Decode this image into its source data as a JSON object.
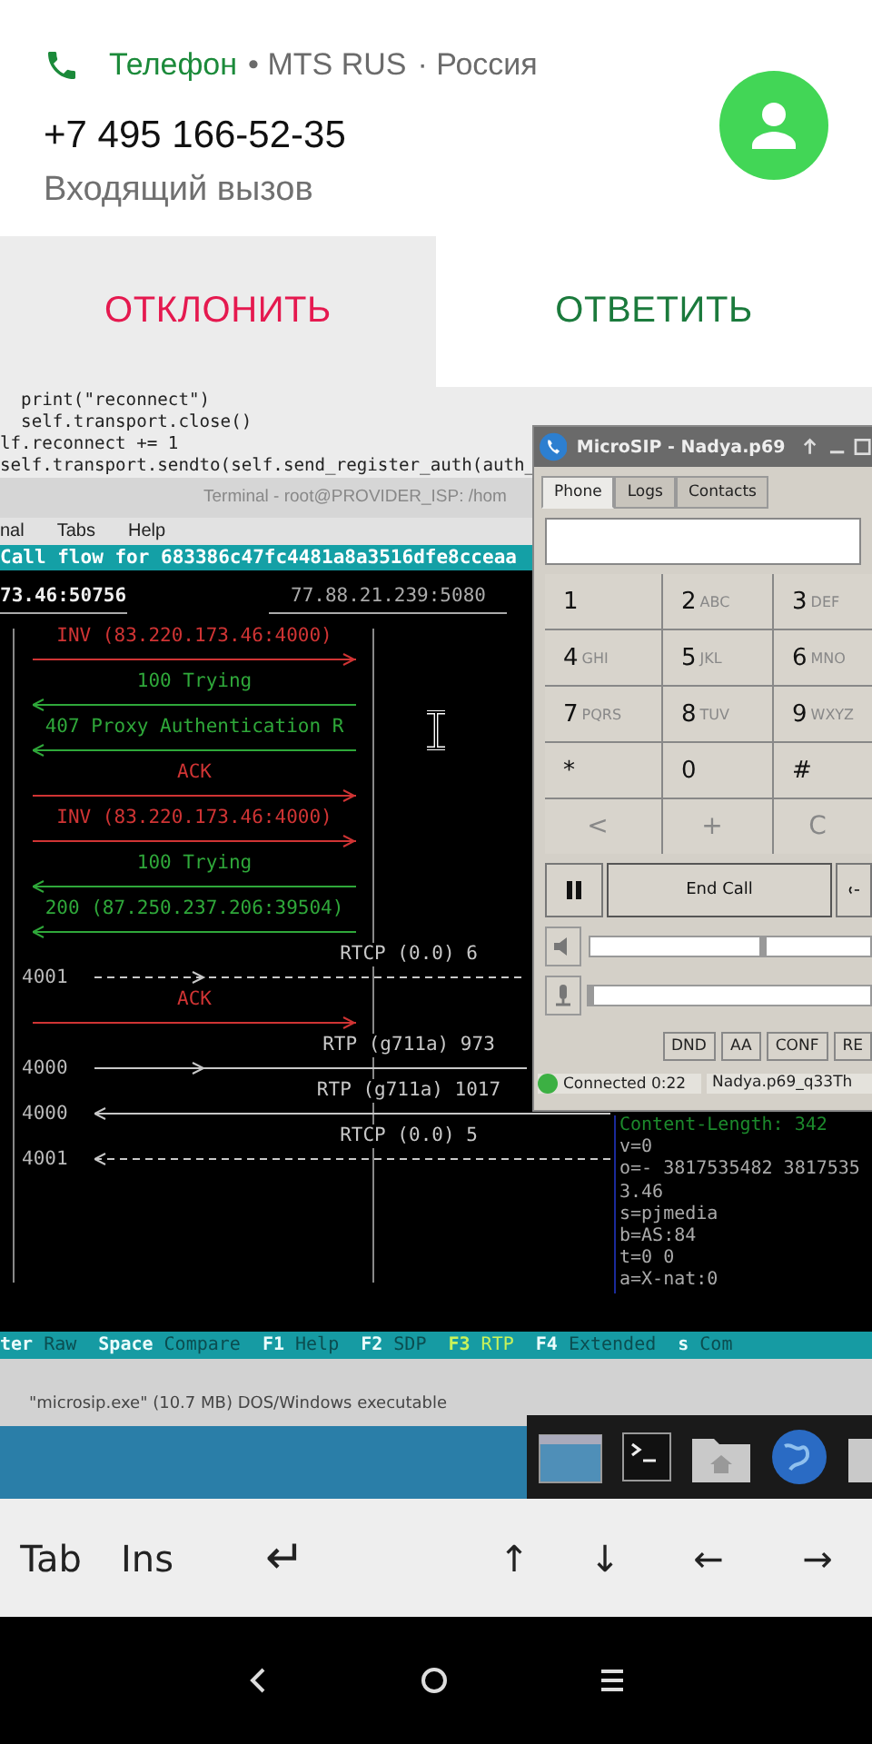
{
  "notification": {
    "header": [
      {
        "text": "Телефон",
        "kind": "app"
      },
      {
        "text": "• MTS RUS",
        "kind": "meta"
      },
      {
        "text": "· Россия",
        "kind": "meta"
      }
    ],
    "caller": "+7 495 166-52-35",
    "status": "Входящий вызов"
  },
  "actions": [
    {
      "label": "ОТКЛОНИТЬ",
      "kind": "decline"
    },
    {
      "label": "ОТВЕТИТЬ",
      "kind": "answer"
    }
  ],
  "remote_desktop": {
    "editor_lines": [
      "  print(\"reconnect\")",
      "  self.transport.close()",
      "lf.reconnect += 1",
      "self.transport.sendto(self.send_register_auth(auth_"
    ],
    "terminal": {
      "title": "Terminal - root@PROVIDER_ISP: /hom",
      "menu": [
        "nal",
        "Tabs",
        "Help"
      ],
      "banner": "Call flow for 683386c47fc4481a8a3516dfe8cceaa",
      "hosts": [
        "73.46:50756",
        "77.88.21.239:5080"
      ],
      "flow": [
        {
          "kind": "request",
          "label": "INV (83.220.173.46:4000)",
          "rightward": true
        },
        {
          "kind": "response",
          "label": "100 Trying",
          "rightward": false
        },
        {
          "kind": "response",
          "label": "407 Proxy Authentication R",
          "rightward": false
        },
        {
          "kind": "request",
          "label": "ACK",
          "rightward": true
        },
        {
          "kind": "request",
          "label": "INV (83.220.173.46:4000)",
          "rightward": true
        },
        {
          "kind": "response",
          "label": "100 Trying",
          "rightward": false
        },
        {
          "kind": "response",
          "label": "200 (87.250.237.206:39504)",
          "rightward": false
        },
        {
          "kind": "media",
          "label": "RTCP (0.0) 6",
          "port": "4001",
          "rightward": true,
          "dashed": true
        },
        {
          "kind": "request",
          "label": "ACK",
          "rightward": true
        },
        {
          "kind": "media",
          "label": "RTP (g711a) 973",
          "port": "4000",
          "rightward": true,
          "dashed": false
        },
        {
          "kind": "media",
          "label": "RTP (g711a) 1017",
          "port": "4000",
          "rightward": false,
          "dashed": false
        },
        {
          "kind": "media",
          "label": "RTCP (0.0) 5",
          "port": "4001",
          "rightward": false,
          "dashed": true
        }
      ],
      "sdp": [
        {
          "text": "Content-Length:   342",
          "kind": "header"
        },
        {
          "text": "v=0",
          "kind": "body"
        },
        {
          "text": "o=- 3817535482 3817535",
          "kind": "body"
        },
        {
          "text": "3.46",
          "kind": "body"
        },
        {
          "text": "s=pjmedia",
          "kind": "body"
        },
        {
          "text": "b=AS:84",
          "kind": "body"
        },
        {
          "text": "t=0 0",
          "kind": "body"
        },
        {
          "text": "a=X-nat:0",
          "kind": "body"
        }
      ],
      "function_keys": [
        {
          "key": "ter",
          "label": "Raw",
          "selected": false
        },
        {
          "key": "Space",
          "label": "Compare",
          "selected": false
        },
        {
          "key": "F1",
          "label": "Help",
          "selected": false
        },
        {
          "key": "F2",
          "label": "SDP",
          "selected": false
        },
        {
          "key": "F3",
          "label": "RTP",
          "selected": true
        },
        {
          "key": "F4",
          "label": "Extended",
          "selected": false
        },
        {
          "key": "s",
          "label": "Com",
          "selected": false
        }
      ]
    },
    "file_status": "\"microsip.exe\" (10.7 MB) DOS/Windows executable",
    "microsip": {
      "title": "MicroSIP - Nadya.p69",
      "tabs": [
        {
          "label": "Phone",
          "selected": true
        },
        {
          "label": "Logs",
          "selected": false
        },
        {
          "label": "Contacts",
          "selected": false
        }
      ],
      "keys": [
        {
          "digit": "1"
        },
        {
          "digit": "2",
          "letters": "ABC"
        },
        {
          "digit": "3",
          "letters": "DEF"
        },
        {
          "digit": "4",
          "letters": "GHI"
        },
        {
          "digit": "5",
          "letters": "JKL"
        },
        {
          "digit": "6",
          "letters": "MNO"
        },
        {
          "digit": "7",
          "letters": "PQRS"
        },
        {
          "digit": "8",
          "letters": "TUV"
        },
        {
          "digit": "9",
          "letters": "WXYZ"
        },
        {
          "digit": "*"
        },
        {
          "digit": "0"
        },
        {
          "digit": "#"
        }
      ],
      "controls": [
        "<",
        "+",
        "C"
      ],
      "end_call": "End Call",
      "sliders": [
        {
          "kind": "speaker",
          "level": 0.62
        },
        {
          "kind": "microphone",
          "level": 0
        }
      ],
      "options": [
        "DND",
        "AA",
        "CONF",
        "RE"
      ],
      "status": "Connected 0:22",
      "account": "Nadya.p69_q33Th"
    }
  },
  "extra_keys": [
    "Tab",
    "Ins",
    "↵",
    "↑",
    "↓",
    "←",
    "→"
  ]
}
